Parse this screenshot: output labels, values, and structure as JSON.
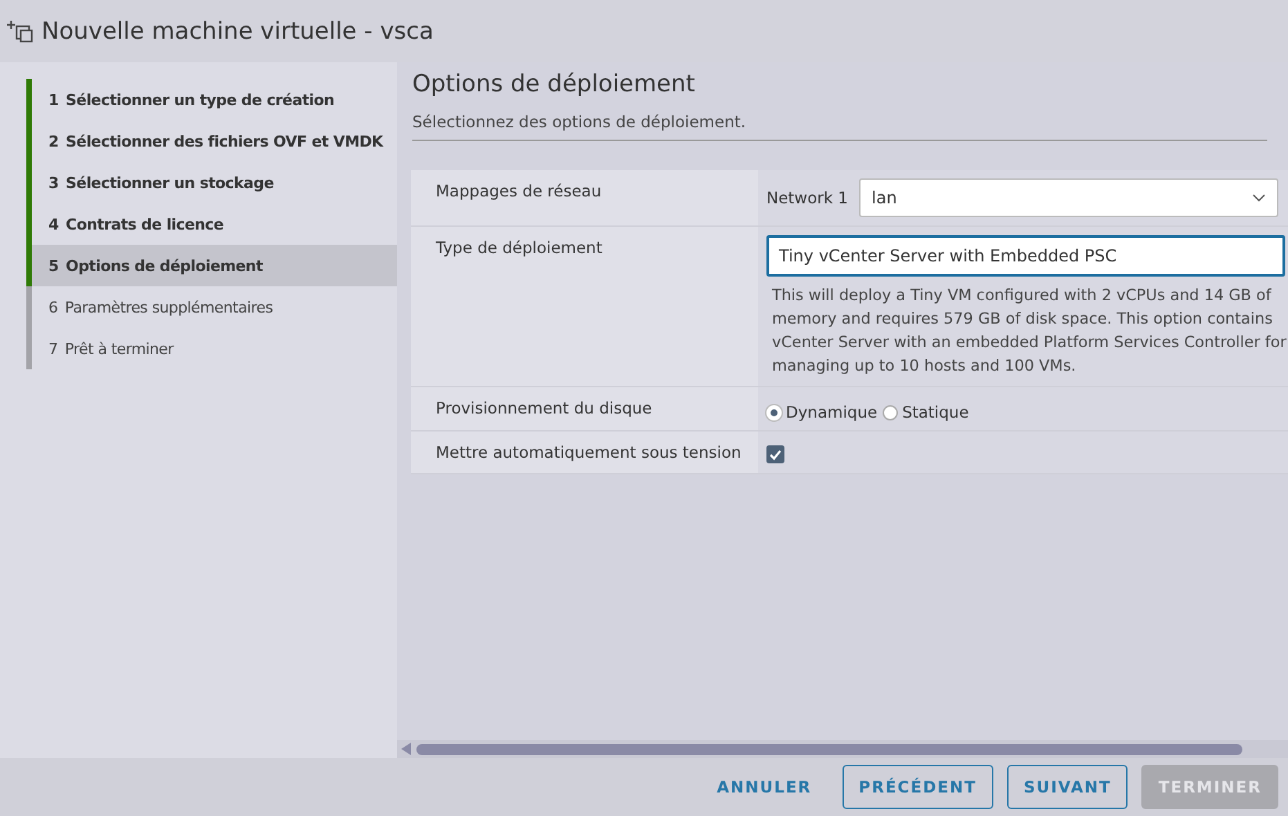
{
  "window": {
    "title": "Nouvelle machine virtuelle - vsca"
  },
  "steps": [
    {
      "number": "1",
      "label": "Sélectionner un type de création",
      "completed": true,
      "selected": false
    },
    {
      "number": "2",
      "label": "Sélectionner des fichiers OVF et VMDK",
      "completed": true,
      "selected": false
    },
    {
      "number": "3",
      "label": "Sélectionner un stockage",
      "completed": true,
      "selected": false
    },
    {
      "number": "4",
      "label": "Contrats de licence",
      "completed": true,
      "selected": false
    },
    {
      "number": "5",
      "label": "Options de déploiement",
      "completed": true,
      "selected": true
    },
    {
      "number": "6",
      "label": "Paramètres supplémentaires",
      "completed": false,
      "selected": false
    },
    {
      "number": "7",
      "label": "Prêt à terminer",
      "completed": false,
      "selected": false
    }
  ],
  "page": {
    "title": "Options de déploiement",
    "subtitle": "Sélectionnez des options de déploiement."
  },
  "form": [
    {
      "kind": "select",
      "label": "Mappages de réseau",
      "field_label": "Network 1",
      "value": "lan"
    },
    {
      "kind": "input",
      "label": "Type de déploiement",
      "value": "Tiny vCenter Server with Embedded PSC",
      "focused": true,
      "description": "This will deploy a Tiny VM configured with 2 vCPUs and 14 GB of memory and requires 579 GB of disk space. This option contains vCenter Server with an embedded Platform Services Controller for managing up to 10 hosts and 100 VMs."
    },
    {
      "kind": "radio",
      "label": "Provisionnement du disque",
      "options": [
        {
          "label": "Dynamique",
          "selected": true
        },
        {
          "label": "Statique",
          "selected": false
        }
      ]
    },
    {
      "kind": "checkbox",
      "label": "Mettre automatiquement sous tension",
      "checked": true
    }
  ],
  "buttons": [
    {
      "label": "ANNULER",
      "kind": "flat",
      "disabled": false
    },
    {
      "label": "PRÉCÉDENT",
      "kind": "outline",
      "disabled": false
    },
    {
      "label": "SUIVANT",
      "kind": "outline",
      "disabled": false
    },
    {
      "label": "TERMINER",
      "kind": "solid",
      "disabled": true
    }
  ]
}
